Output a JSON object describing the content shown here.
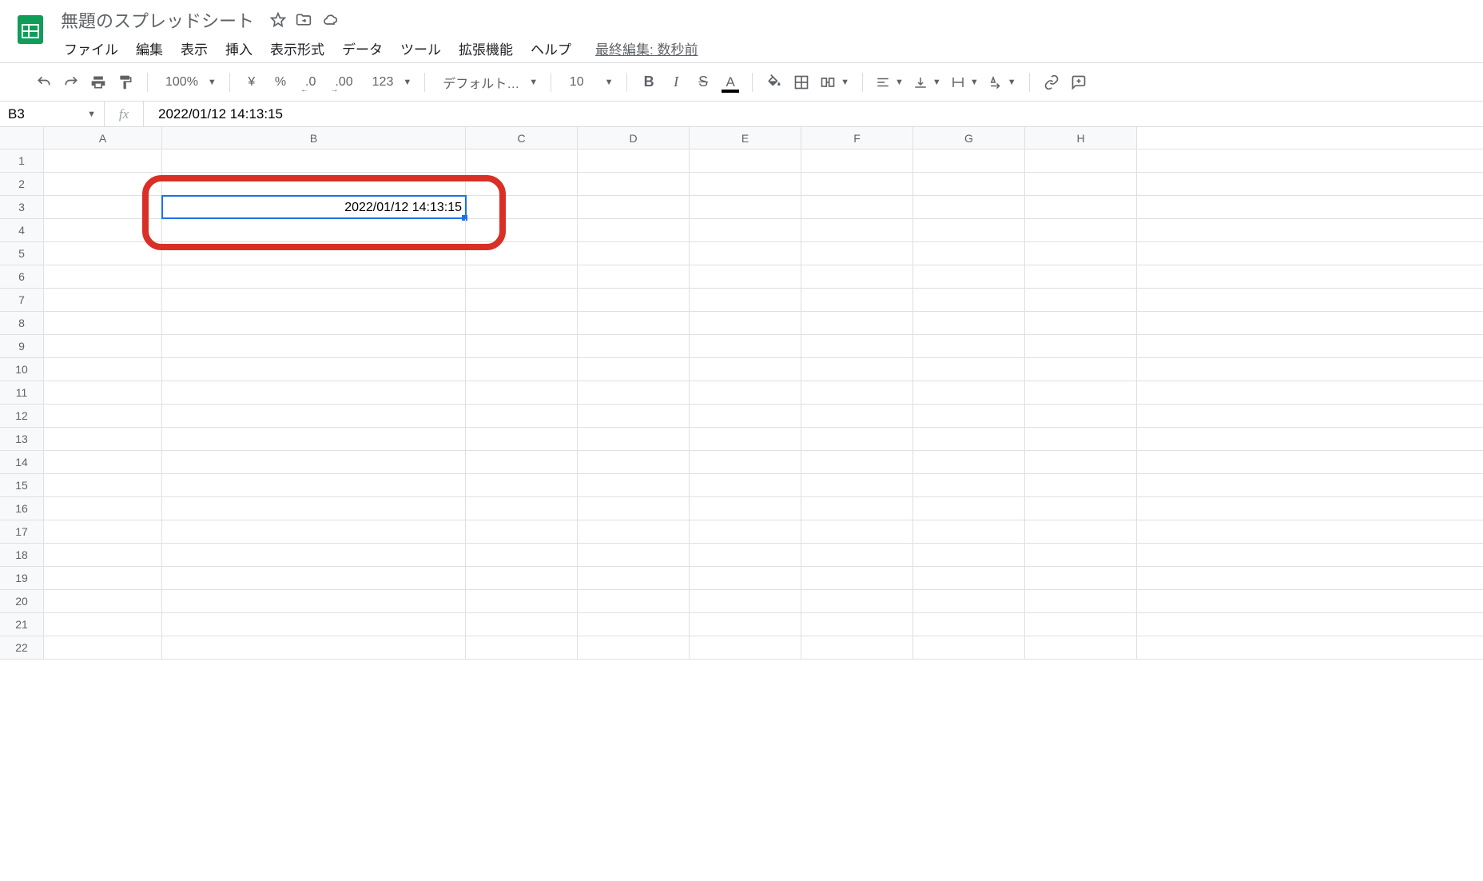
{
  "header": {
    "doc_title": "無題のスプレッドシート",
    "menus": [
      "ファイル",
      "編集",
      "表示",
      "挿入",
      "表示形式",
      "データ",
      "ツール",
      "拡張機能",
      "ヘルプ"
    ],
    "last_edit": "最終編集: 数秒前"
  },
  "toolbar": {
    "zoom": "100%",
    "currency": "¥",
    "percent": "%",
    "dec_minus": ".0",
    "dec_plus": ".00",
    "more_formats": "123",
    "font": "デフォルト…",
    "font_size": "10"
  },
  "namebar": {
    "cell_ref": "B3",
    "fx": "fx",
    "formula": "2022/01/12 14:13:15"
  },
  "grid": {
    "columns": [
      "A",
      "B",
      "C",
      "D",
      "E",
      "F",
      "G",
      "H"
    ],
    "row_count": 22,
    "selected": {
      "row": 3,
      "col": "B"
    },
    "cells": {
      "B3": "2022/01/12 14:13:15"
    }
  }
}
